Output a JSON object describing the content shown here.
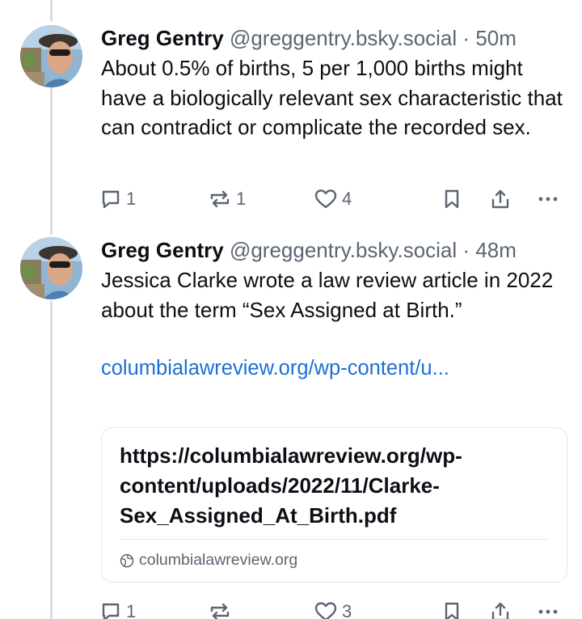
{
  "posts": [
    {
      "author": "Greg Gentry",
      "handle": "@greggentry.bsky.social",
      "separator": "·",
      "time": "50m",
      "text": "About 0.5% of births, 5 per 1,000 births might have a biologically relevant sex characteristic that can contradict or complicate the recorded sex.",
      "reply_count": "1",
      "repost_count": "1",
      "like_count": "4"
    },
    {
      "author": "Greg Gentry",
      "handle": "@greggentry.bsky.social",
      "separator": "·",
      "time": "48m",
      "text": "Jessica Clarke wrote a law review article in 2022 about the term “Sex Assigned at Birth.”",
      "link_text": "columbialawreview.org/wp-content/u...",
      "card": {
        "title": "https://columbialawreview.org/wp-content/uploads/2022/11/Clarke-Sex_Assigned_At_Birth.pdf",
        "domain": "columbialawreview.org"
      },
      "reply_count": "1",
      "repost_count": "",
      "like_count": "3"
    }
  ],
  "icons": {
    "reply": "reply-icon",
    "repost": "repost-icon",
    "like": "heart-icon",
    "bookmark": "bookmark-icon",
    "share": "share-icon",
    "more": "more-icon",
    "globe": "globe-icon"
  },
  "colors": {
    "link": "#1a6fd8",
    "muted": "#5b6672",
    "thread_line": "#d4dbe2"
  }
}
